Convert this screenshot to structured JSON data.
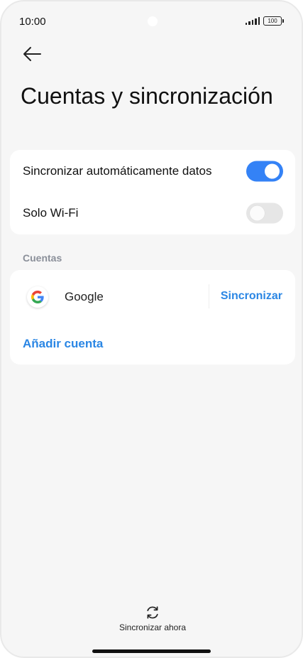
{
  "status_bar": {
    "time": "10:00",
    "battery": "100"
  },
  "header": {
    "title": "Cuentas y sincronización"
  },
  "sync_settings": [
    {
      "label": "Sincronizar automáticamente datos",
      "enabled": true
    },
    {
      "label": "Solo Wi-Fi",
      "enabled": false
    }
  ],
  "accounts_section": {
    "header": "Cuentas",
    "accounts": [
      {
        "name": "Google",
        "action": "Sincronizar"
      }
    ],
    "add_account": "Añadir cuenta"
  },
  "footer": {
    "sync_now": "Sincronizar ahora"
  },
  "colors": {
    "accent": "#2a86e4",
    "toggle_on": "#3482f6",
    "toggle_off": "#e6e6e6",
    "background": "#f6f6f6"
  }
}
